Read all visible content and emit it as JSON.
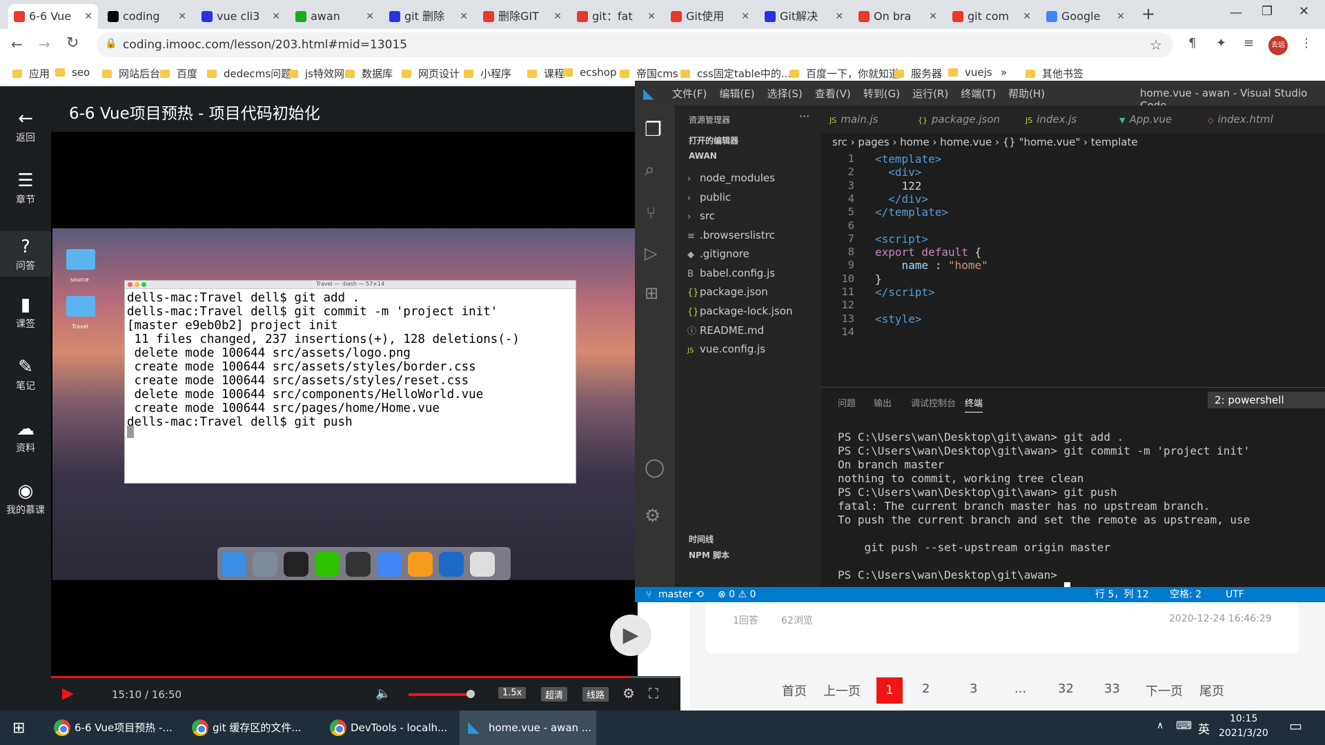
{
  "browser": {
    "tabs": [
      {
        "label": "6-6 Vue",
        "color": "#e8392a",
        "active": true
      },
      {
        "label": "coding",
        "color": "#000000"
      },
      {
        "label": "vue cli3",
        "color": "#2932e1"
      },
      {
        "label": "awan",
        "color": "#1aad19"
      },
      {
        "label": "git 删除",
        "color": "#2932e1"
      },
      {
        "label": "删除GIT",
        "color": "#e8392a"
      },
      {
        "label": "git：fat",
        "color": "#e8392a"
      },
      {
        "label": "Git使用",
        "color": "#e8392a"
      },
      {
        "label": "Git解决",
        "color": "#2932e1"
      },
      {
        "label": "On bra",
        "color": "#e8392a"
      },
      {
        "label": "git com",
        "color": "#e8392a"
      },
      {
        "label": "Google",
        "color": "#4285f4"
      }
    ],
    "url": "coding.imooc.com/lesson/203.html#mid=13015",
    "profile": "去远",
    "bookmarks": [
      "应用",
      "seo",
      "网站后台",
      "百度",
      "dedecms问题",
      "js特效网",
      "数据库",
      "网页设计",
      "小程序",
      "课程",
      "ecshop",
      "帝国cms",
      "css固定table中的...",
      "百度一下，你就知道",
      "服务器",
      "vuejs",
      "»",
      "其他书签"
    ]
  },
  "sidebar": {
    "items": [
      {
        "icon": "←",
        "label": "返回"
      },
      {
        "icon": "☰",
        "label": "章节"
      },
      {
        "icon": "?",
        "label": "问答"
      },
      {
        "icon": "▮",
        "label": "课签"
      },
      {
        "icon": "✎",
        "label": "笔记"
      },
      {
        "icon": "☁",
        "label": "资料"
      },
      {
        "icon": "◉",
        "label": "我的慕课"
      }
    ]
  },
  "lesson": {
    "title": "6-6 Vue项目预热 - 项目代码初始化",
    "time": "15:10 / 16:50",
    "speed": "1.5x",
    "quality": "超清",
    "line": "线路",
    "progress": 0.92
  },
  "mac": {
    "folders": [
      "source",
      "Travel"
    ],
    "terminal_title": "Travel — -bash — 57×14",
    "terminal_text": "dells-mac:Travel dell$ git add .\ndells-mac:Travel dell$ git commit -m 'project init'\n[master e9eb0b2] project init\n 11 files changed, 237 insertions(+), 128 deletions(-)\n delete mode 100644 src/assets/logo.png\n create mode 100644 src/assets/styles/border.css\n create mode 100644 src/assets/styles/reset.css\n delete mode 100644 src/components/HelloWorld.vue\n create mode 100644 src/pages/home/Home.vue\ndells-mac:Travel dell$ git push"
  },
  "vscode": {
    "menu": [
      "文件(F)",
      "编辑(E)",
      "选择(S)",
      "查看(V)",
      "转到(G)",
      "运行(R)",
      "终端(T)",
      "帮助(H)"
    ],
    "title": "home.vue - awan - Visual Studio Code",
    "explorer_title": "资源管理器",
    "open_editors": "打开的编辑器",
    "folder": "AWAN",
    "files": [
      {
        "name": "node_modules",
        "icon": "›"
      },
      {
        "name": "public",
        "icon": "›"
      },
      {
        "name": "src",
        "icon": "›"
      },
      {
        "name": ".browserslistrc",
        "icon": "≡"
      },
      {
        "name": ".gitignore",
        "icon": "◆"
      },
      {
        "name": "babel.config.js",
        "icon": "B"
      },
      {
        "name": "package.json",
        "icon": "{}"
      },
      {
        "name": "package-lock.json",
        "icon": "{}"
      },
      {
        "name": "README.md",
        "icon": "ⓘ"
      },
      {
        "name": "vue.config.js",
        "icon": "JS"
      }
    ],
    "timeline": "时间线",
    "npm": "NPM 脚本",
    "editor_tabs": [
      "main.js",
      "package.json",
      "index.js",
      "App.vue",
      "index.html"
    ],
    "breadcrumb": "src › pages › home › home.vue › {} \"home.vue\" › template",
    "code": [
      {
        "n": "1",
        "html": "<span class='tag'>&lt;template&gt;</span>"
      },
      {
        "n": "2",
        "html": "  <span class='tag'>&lt;div&gt;</span>"
      },
      {
        "n": "3",
        "html": "    122"
      },
      {
        "n": "4",
        "html": "  <span class='tag'>&lt;/div&gt;</span>"
      },
      {
        "n": "5",
        "html": "<span class='tag'>&lt;/template&gt;</span>"
      },
      {
        "n": "6",
        "html": ""
      },
      {
        "n": "7",
        "html": "<span class='tag'>&lt;script&gt;</span>"
      },
      {
        "n": "8",
        "html": "<span class='kw'>export default</span> {"
      },
      {
        "n": "9",
        "html": "    <span class='prop'>name</span> : <span class='str'>\"home\"</span>"
      },
      {
        "n": "10",
        "html": "}"
      },
      {
        "n": "11",
        "html": "<span class='tag'>&lt;/script&gt;</span>"
      },
      {
        "n": "12",
        "html": ""
      },
      {
        "n": "13",
        "html": "<span class='tag'>&lt;style&gt;</span>"
      },
      {
        "n": "14",
        "html": ""
      }
    ],
    "panel_tabs": [
      "问题",
      "输出",
      "调试控制台",
      "终端"
    ],
    "panel_select": "2: powershell",
    "terminal": "PS C:\\Users\\wan\\Desktop\\git\\awan> git add .\nPS C:\\Users\\wan\\Desktop\\git\\awan> git commit -m 'project init'\nOn branch master\nnothing to commit, working tree clean\nPS C:\\Users\\wan\\Desktop\\git\\awan> git push\nfatal: The current branch master has no upstream branch.\nTo push the current branch and set the remote as upstream, use\n\n    git push --set-upstream origin master\n\nPS C:\\Users\\wan\\Desktop\\git\\awan> ",
    "status_branch": "master",
    "status_errors": "⊗ 0 ⚠ 0",
    "status_pos": "行 5，列 12",
    "status_space": "空格: 2",
    "status_enc": "UTF"
  },
  "qa": {
    "answers": "1回答",
    "views": "62浏览",
    "date": "2020-12-24 16:46:29"
  },
  "pagination": [
    "首页",
    "上一页",
    "1",
    "2",
    "3",
    "...",
    "32",
    "33",
    "下一页",
    "尾页"
  ],
  "taskbar": {
    "items": [
      "6-6 Vue项目预热 -...",
      "git 缓存区的文件...",
      "DevTools - localh...",
      "home.vue - awan ..."
    ],
    "ime": "英",
    "time": "10:15",
    "date": "2021/3/20"
  }
}
